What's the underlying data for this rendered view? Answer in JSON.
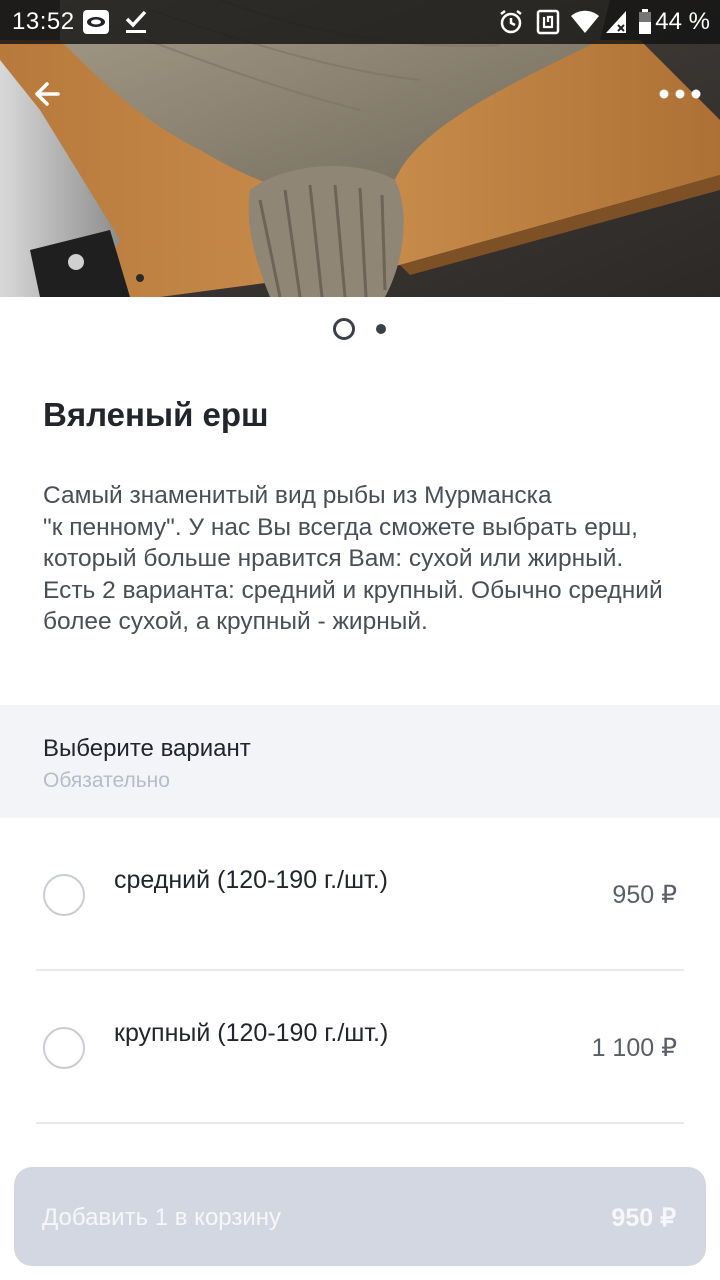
{
  "status_bar": {
    "time": "13:52",
    "battery_percent": "44 %",
    "icons": [
      "eye-notification-icon",
      "check-icon",
      "alarm-icon",
      "nfc-icon",
      "wifi-icon",
      "signal-icon",
      "battery-icon"
    ]
  },
  "toolbar": {
    "back_icon": "arrow-left-icon",
    "more_icon": "more-horizontal-icon"
  },
  "gallery": {
    "image": "dried-fish-photo",
    "page_count": 2,
    "current_page": 1
  },
  "product": {
    "title": "Вяленый ерш",
    "description": "Самый знаменитый вид рыбы из Мурманска\n\"к пенному\". У нас Вы всегда сможете выбрать ерш, который больше нравится Вам: сухой или жирный.\nЕсть 2 варианта: средний и крупный. Обычно средний более сухой, а крупный - жирный."
  },
  "variants": {
    "title": "Выберите вариант",
    "subtitle": "Обязательно",
    "options": [
      {
        "label": "средний (120-190 г./шт.)",
        "price": "950 ₽",
        "selected": false
      },
      {
        "label": "крупный (120-190 г./шт.)",
        "price": "1 100 ₽",
        "selected": false
      }
    ]
  },
  "cart_button": {
    "label": "Добавить 1 в корзину",
    "price": "950 ₽"
  },
  "colors": {
    "text_primary": "#22252b",
    "text_secondary": "#4a4e57",
    "section_background": "#f2f4f8",
    "button_disabled": "#d3d7e1"
  }
}
